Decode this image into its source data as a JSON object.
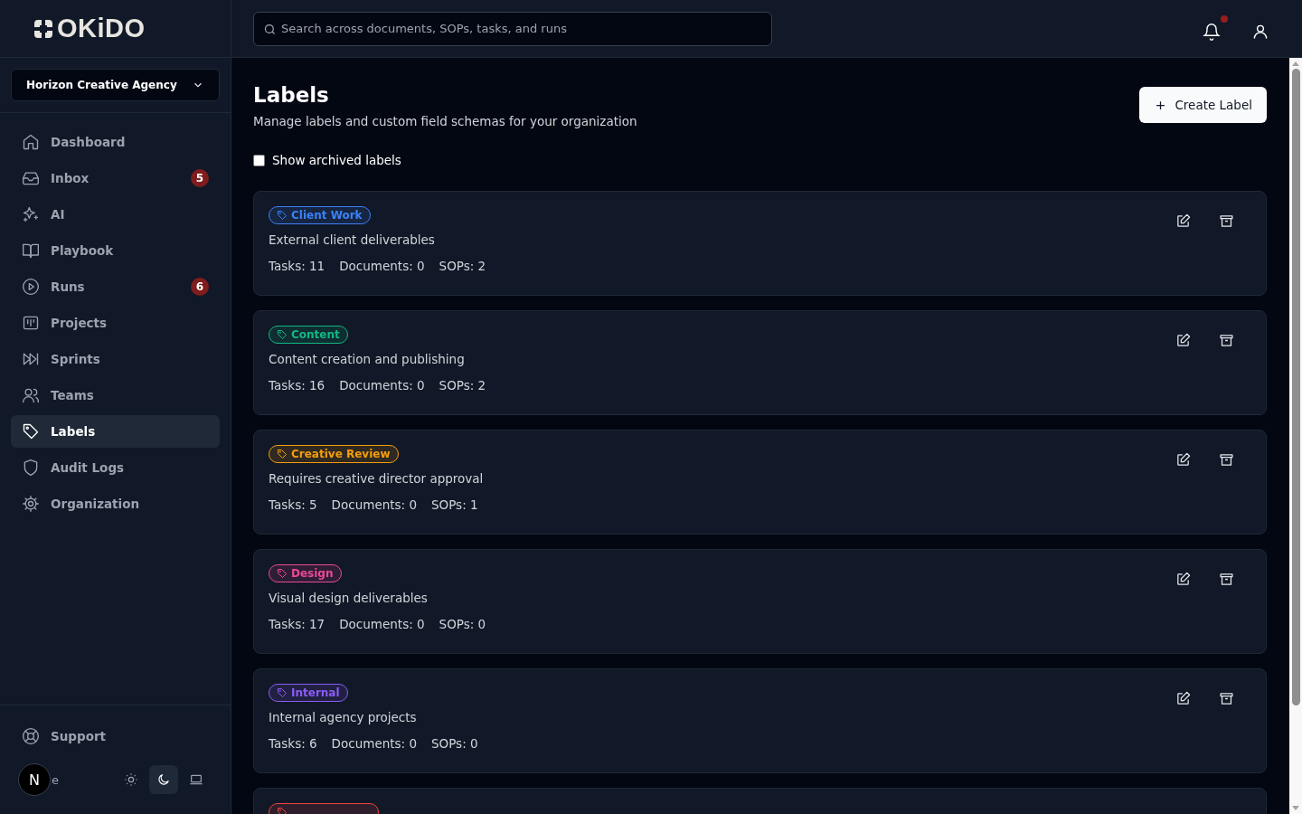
{
  "brand": {
    "name": "OKiDO"
  },
  "org_switcher": {
    "value": "Horizon Creative Agency"
  },
  "sidebar": {
    "items": [
      {
        "label": "Dashboard",
        "selected": false
      },
      {
        "label": "Inbox",
        "selected": false,
        "badge": "5"
      },
      {
        "label": "AI",
        "selected": false
      },
      {
        "label": "Playbook",
        "selected": false
      },
      {
        "label": "Runs",
        "selected": false,
        "badge": "6"
      },
      {
        "label": "Projects",
        "selected": false
      },
      {
        "label": "Sprints",
        "selected": false
      },
      {
        "label": "Teams",
        "selected": false
      },
      {
        "label": "Labels",
        "selected": true
      },
      {
        "label": "Audit Logs",
        "selected": false
      },
      {
        "label": "Organization",
        "selected": false
      }
    ],
    "support": "Support",
    "avatar": "N",
    "theme_label": "e",
    "theme_modes": [
      {
        "selected": false
      },
      {
        "selected": true
      },
      {
        "selected": false
      }
    ]
  },
  "search": {
    "placeholder": "Search across documents, SOPs, tasks, and runs"
  },
  "notifications": {
    "unread": true
  },
  "page": {
    "title": "Labels",
    "subtitle": "Manage labels and custom field schemas for your organization",
    "create_button": "Create Label",
    "show_archived": {
      "label": "Show archived labels",
      "checked": false
    }
  },
  "labels": [
    {
      "name": "Client Work",
      "color": "#3b82f6",
      "description": "External client deliverables",
      "stats": [
        "Tasks: 11",
        "Documents: 0",
        "SOPs: 2"
      ]
    },
    {
      "name": "Content",
      "color": "#10b981",
      "description": "Content creation and publishing",
      "stats": [
        "Tasks: 16",
        "Documents: 0",
        "SOPs: 2"
      ]
    },
    {
      "name": "Creative Review",
      "color": "#f59e0b",
      "description": "Requires creative director approval",
      "stats": [
        "Tasks: 5",
        "Documents: 0",
        "SOPs: 1"
      ]
    },
    {
      "name": "Design",
      "color": "#ec4899",
      "description": "Visual design deliverables",
      "stats": [
        "Tasks: 17",
        "Documents: 0",
        "SOPs: 0"
      ]
    },
    {
      "name": "Internal",
      "color": "#8b5cf6",
      "description": "Internal agency projects",
      "stats": [
        "Tasks: 6",
        "Documents: 0",
        "SOPs: 0"
      ]
    },
    {
      "color": "#ef4444"
    }
  ]
}
